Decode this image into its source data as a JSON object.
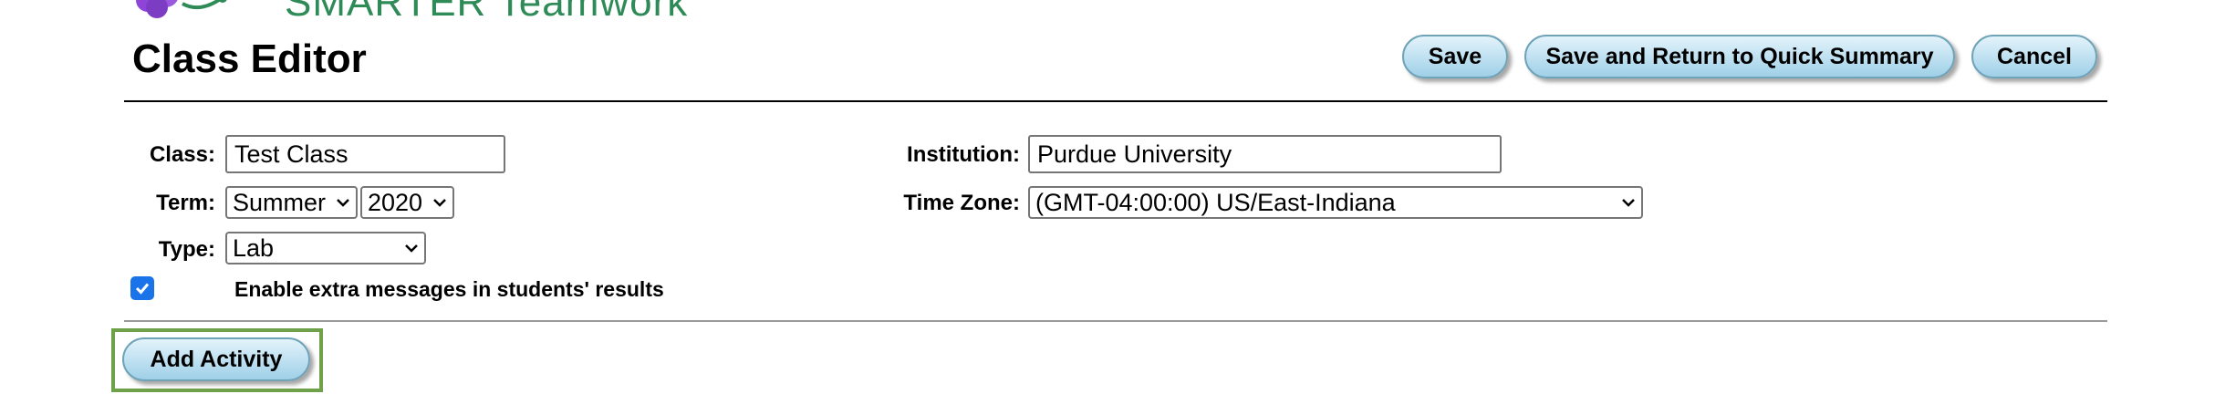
{
  "header": {
    "logo_text": "SMARTER Teamwork",
    "page_title": "Class Editor"
  },
  "toolbar": {
    "save_label": "Save",
    "save_return_label": "Save and Return to Quick Summary",
    "cancel_label": "Cancel"
  },
  "form": {
    "class_label": "Class:",
    "class_value": "Test Class",
    "institution_label": "Institution:",
    "institution_value": "Purdue University",
    "term_label": "Term:",
    "term_value": "Summer",
    "year_value": "2020",
    "timezone_label": "Time Zone:",
    "timezone_value": "(GMT-04:00:00) US/East-Indiana",
    "type_label": "Type:",
    "type_value": "Lab",
    "extra_messages_checked": true,
    "extra_messages_label": "Enable extra messages in students' results"
  },
  "actions": {
    "add_activity_label": "Add Activity"
  },
  "colors": {
    "logo_green": "#2e8b57",
    "button_gradient_top": "#e3f3fb",
    "button_gradient_bottom": "#9fd0e8",
    "checkbox_blue": "#1a73e8",
    "highlight_green": "#6fa04a"
  },
  "icons": {
    "logo": "molecule-logo-icon",
    "select_arrow": "chevron-down-icon",
    "checkbox": "checkmark-icon"
  }
}
